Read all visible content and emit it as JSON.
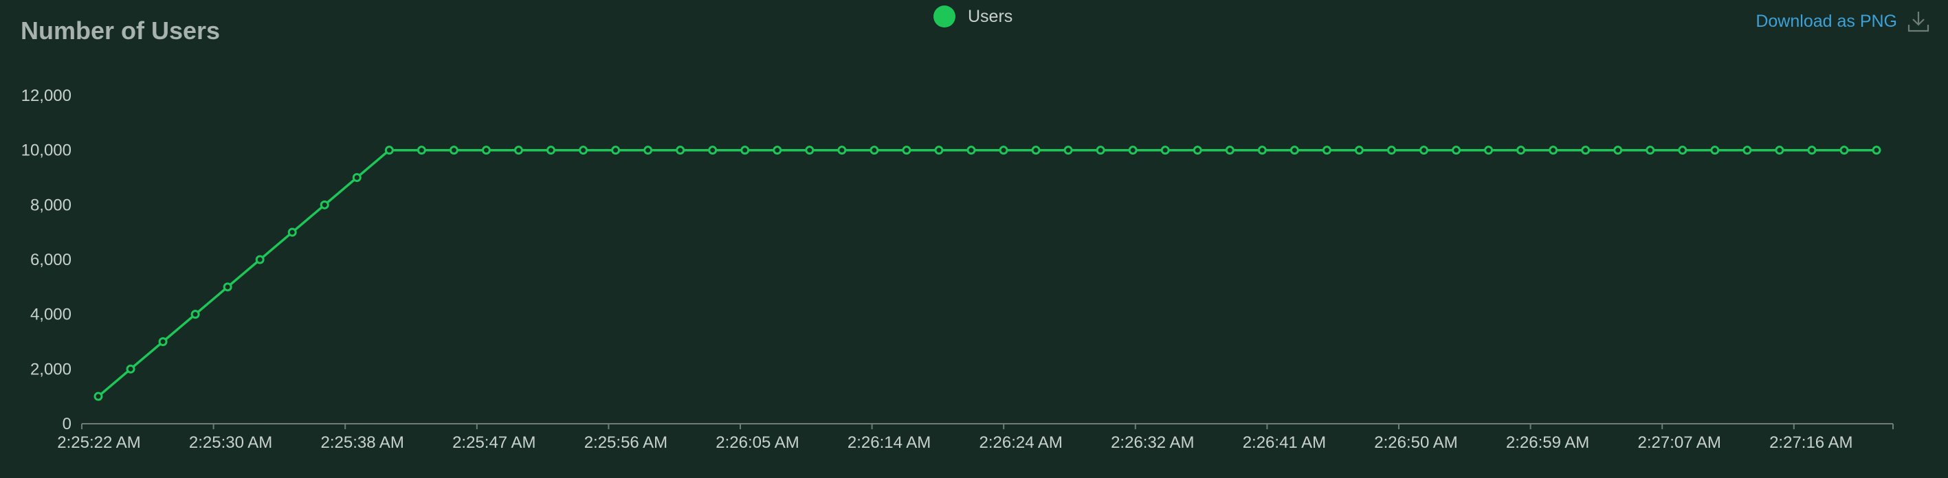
{
  "title": "Number of Users",
  "download": {
    "label": "Download as PNG",
    "icon": "download-icon"
  },
  "colors": {
    "series": "#1ec658",
    "axis": "#6f7c77",
    "background": "#152b24"
  },
  "chart_data": {
    "type": "line",
    "title": "Number of Users",
    "xlabel": "",
    "ylabel": "",
    "ylim": [
      0,
      12000
    ],
    "yticks": [
      0,
      2000,
      4000,
      6000,
      8000,
      10000,
      12000
    ],
    "ytick_labels": [
      "0",
      "2,000",
      "4,000",
      "6,000",
      "8,000",
      "10,000",
      "12,000"
    ],
    "xtick_labels": [
      "2:25:22 AM",
      "2:25:30 AM",
      "2:25:38 AM",
      "2:25:47 AM",
      "2:25:56 AM",
      "2:26:05 AM",
      "2:26:14 AM",
      "2:26:24 AM",
      "2:26:32 AM",
      "2:26:41 AM",
      "2:26:50 AM",
      "2:26:59 AM",
      "2:27:07 AM",
      "2:27:16 AM"
    ],
    "grid": false,
    "legend": "top-center",
    "series": [
      {
        "name": "Users",
        "color": "#1ec658",
        "values": [
          1000,
          2000,
          3000,
          4000,
          5000,
          6000,
          7000,
          8000,
          9000,
          10000,
          10000,
          10000,
          10000,
          10000,
          10000,
          10000,
          10000,
          10000,
          10000,
          10000,
          10000,
          10000,
          10000,
          10000,
          10000,
          10000,
          10000,
          10000,
          10000,
          10000,
          10000,
          10000,
          10000,
          10000,
          10000,
          10000,
          10000,
          10000,
          10000,
          10000,
          10000,
          10000,
          10000,
          10000,
          10000,
          10000,
          10000,
          10000,
          10000,
          10000,
          10000,
          10000,
          10000,
          10000,
          10000,
          10000
        ]
      }
    ]
  }
}
